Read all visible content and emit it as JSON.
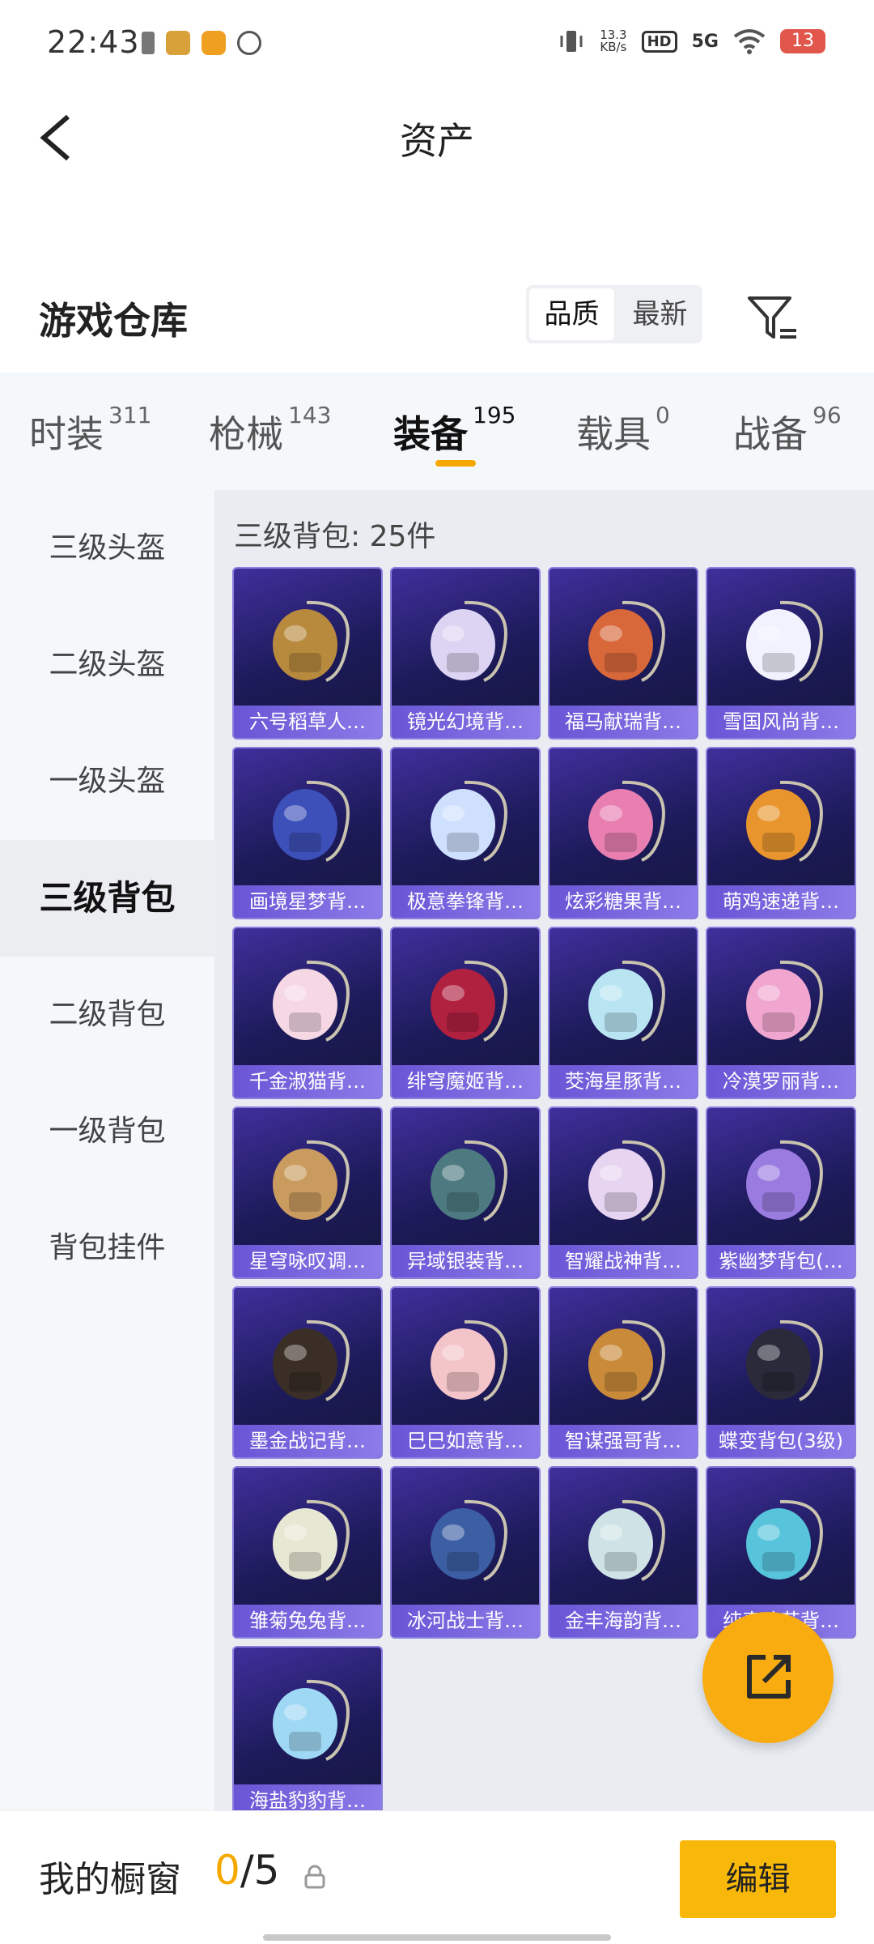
{
  "status_bar": {
    "time": "22:43",
    "net_speed_value": "13.3",
    "net_speed_unit": "KB/s",
    "hd_label": "HD",
    "network": "5G",
    "battery": "13"
  },
  "nav": {
    "title": "资产"
  },
  "warehouse": {
    "title": "游戏仓库",
    "sort_options": [
      "品质",
      "最新"
    ],
    "active_sort": "品质"
  },
  "tabs": [
    {
      "label": "时装",
      "count": "311"
    },
    {
      "label": "枪械",
      "count": "143"
    },
    {
      "label": "装备",
      "count": "195"
    },
    {
      "label": "载具",
      "count": "0"
    },
    {
      "label": "战备",
      "count": "96"
    }
  ],
  "active_tab": "装备",
  "sidebar": {
    "items": [
      {
        "label": "三级头盔"
      },
      {
        "label": "二级头盔"
      },
      {
        "label": "一级头盔"
      },
      {
        "label": "三级背包"
      },
      {
        "label": "二级背包"
      },
      {
        "label": "一级背包"
      },
      {
        "label": "背包挂件"
      }
    ],
    "active": "三级背包"
  },
  "content": {
    "group_title": "三级背包: 25件",
    "items": [
      {
        "label": "六号稻草人…",
        "icon": "scarecrow-backpack-icon",
        "color": "#b88a3e"
      },
      {
        "label": "镜光幻境背…",
        "icon": "crystal-wing-backpack-icon",
        "color": "#dcd4f2"
      },
      {
        "label": "福马献瑞背…",
        "icon": "horse-backpack-icon",
        "color": "#d8673a"
      },
      {
        "label": "雪国风尚背…",
        "icon": "snowman-backpack-icon",
        "color": "#f2f2ff"
      },
      {
        "label": "画境星梦背…",
        "icon": "mirror-backpack-icon",
        "color": "#3d4fb8"
      },
      {
        "label": "极意拳锋背…",
        "icon": "cloud-backpack-icon",
        "color": "#cfe0ff"
      },
      {
        "label": "炫彩糖果背…",
        "icon": "donut-backpack-icon",
        "color": "#e97fb1"
      },
      {
        "label": "萌鸡速递背…",
        "icon": "chick-backpack-icon",
        "color": "#e8952e"
      },
      {
        "label": "千金淑猫背…",
        "icon": "cat-backpack-icon",
        "color": "#f6d8e4"
      },
      {
        "label": "绯穹魔姬背…",
        "icon": "bat-backpack-icon",
        "color": "#b0203f"
      },
      {
        "label": "茭海星豚背…",
        "icon": "dolphin-backpack-icon",
        "color": "#b9e5f3"
      },
      {
        "label": "冷漠罗丽背…",
        "icon": "heart-backpack-icon",
        "color": "#f1a6cf"
      },
      {
        "label": "星穹咏叹调…",
        "icon": "harp-backpack-icon",
        "color": "#c99b5e"
      },
      {
        "label": "异域银装背…",
        "icon": "tactical-backpack-icon",
        "color": "#4d7a80"
      },
      {
        "label": "智耀战神背…",
        "icon": "goddess-backpack-icon",
        "color": "#e7d4f0"
      },
      {
        "label": "紫幽梦背包(…",
        "icon": "lotus-backpack-icon",
        "color": "#9a7be0"
      },
      {
        "label": "墨金战记背…",
        "icon": "dark-armor-backpack-icon",
        "color": "#3a2e26"
      },
      {
        "label": "巳巳如意背…",
        "icon": "snake-backpack-icon",
        "color": "#f3c4c8"
      },
      {
        "label": "智谋强哥背…",
        "icon": "bear-backpack-icon",
        "color": "#c98a3a"
      },
      {
        "label": "蝶变背包(3级)",
        "icon": "butterfly-backpack-icon",
        "color": "#2a2a3a"
      },
      {
        "label": "雏菊兔兔背…",
        "icon": "bunny-backpack-icon",
        "color": "#e7e8d3"
      },
      {
        "label": "冰河战士背…",
        "icon": "robot-backpack-icon",
        "color": "#3c5fa3"
      },
      {
        "label": "金丰海韵背…",
        "icon": "shell-backpack-icon",
        "color": "#cfe3e6"
      },
      {
        "label": "纯真冰艺背…",
        "icon": "icecream-backpack-icon",
        "color": "#57c4dc"
      },
      {
        "label": "海盐豹豹背…",
        "icon": "seal-backpack-icon",
        "color": "#9fd8f4"
      }
    ]
  },
  "showcase": {
    "title": "我的橱窗",
    "used": "0",
    "total": "/5",
    "edit_label": "编辑"
  },
  "colors": {
    "accent": "#f5a800",
    "card_border": "#8b7fe0",
    "card_label_bg": "#7a66de"
  }
}
